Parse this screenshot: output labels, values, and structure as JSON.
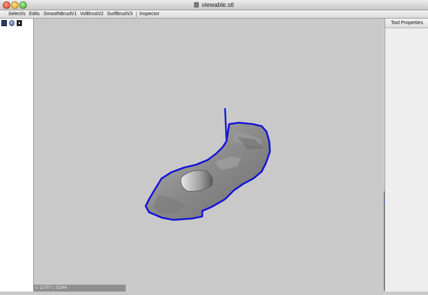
{
  "window": {
    "title": "viewable.stl"
  },
  "menu": {
    "items": [
      {
        "label": "Select/s"
      },
      {
        "label": "Edits"
      },
      {
        "label": "SmoothBrush/1"
      },
      {
        "label": "VolBrush/2"
      },
      {
        "label": "SurfBrush/3"
      },
      {
        "label": "Inspector"
      }
    ]
  },
  "tools": [
    "select-tool-icon",
    "sphere-tool-icon",
    "box-tool-icon"
  ],
  "status": {
    "text": "v: 11707 t: 22244"
  },
  "right_panel": {
    "title": "Tool Properties"
  },
  "colors": {
    "selection_boundary": "#1414d8",
    "mesh": "#8c8c8c",
    "viewport_bg": "#c9c9c9"
  }
}
